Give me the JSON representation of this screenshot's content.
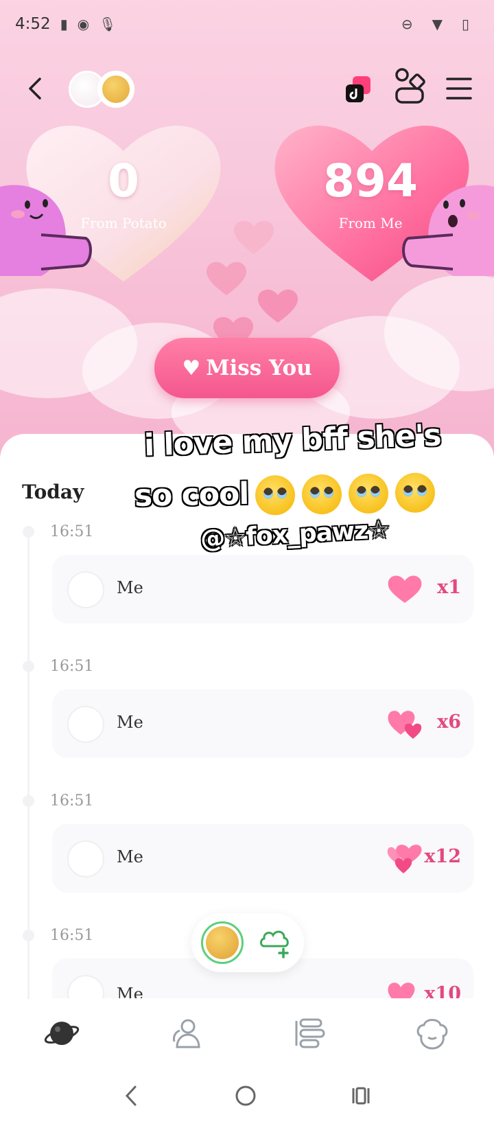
{
  "status_bar": {
    "time": "4:52"
  },
  "counters": {
    "left_value": "0",
    "left_label": "From Potato",
    "right_value": "894",
    "right_label": "From Me"
  },
  "miss_button": {
    "label": "Miss You"
  },
  "timeline": {
    "section_label": "Today",
    "entries": [
      {
        "time": "16:51",
        "who": "Me",
        "multiplier": "x1"
      },
      {
        "time": "16:51",
        "who": "Me",
        "multiplier": "x6"
      },
      {
        "time": "16:51",
        "who": "Me",
        "multiplier": "x12"
      },
      {
        "time": "16:51",
        "who": "Me",
        "multiplier": "x10"
      }
    ]
  },
  "overlay": {
    "line1": "i love my bff she's",
    "line2": "so cool",
    "handle": "@☆fox_pawz☆"
  },
  "colors": {
    "accent": "#f4578d",
    "multiplier": "#e2497e",
    "online_ring": "#5ccf7a"
  },
  "icons": {
    "top": [
      "back-icon",
      "tiktok-icon",
      "shapes-icon",
      "menu-icon"
    ],
    "bottom_nav": [
      "planet-icon",
      "friends-icon",
      "list-icon",
      "pet-face-icon"
    ],
    "system_nav": [
      "system-back-icon",
      "home-icon",
      "recents-icon"
    ]
  }
}
